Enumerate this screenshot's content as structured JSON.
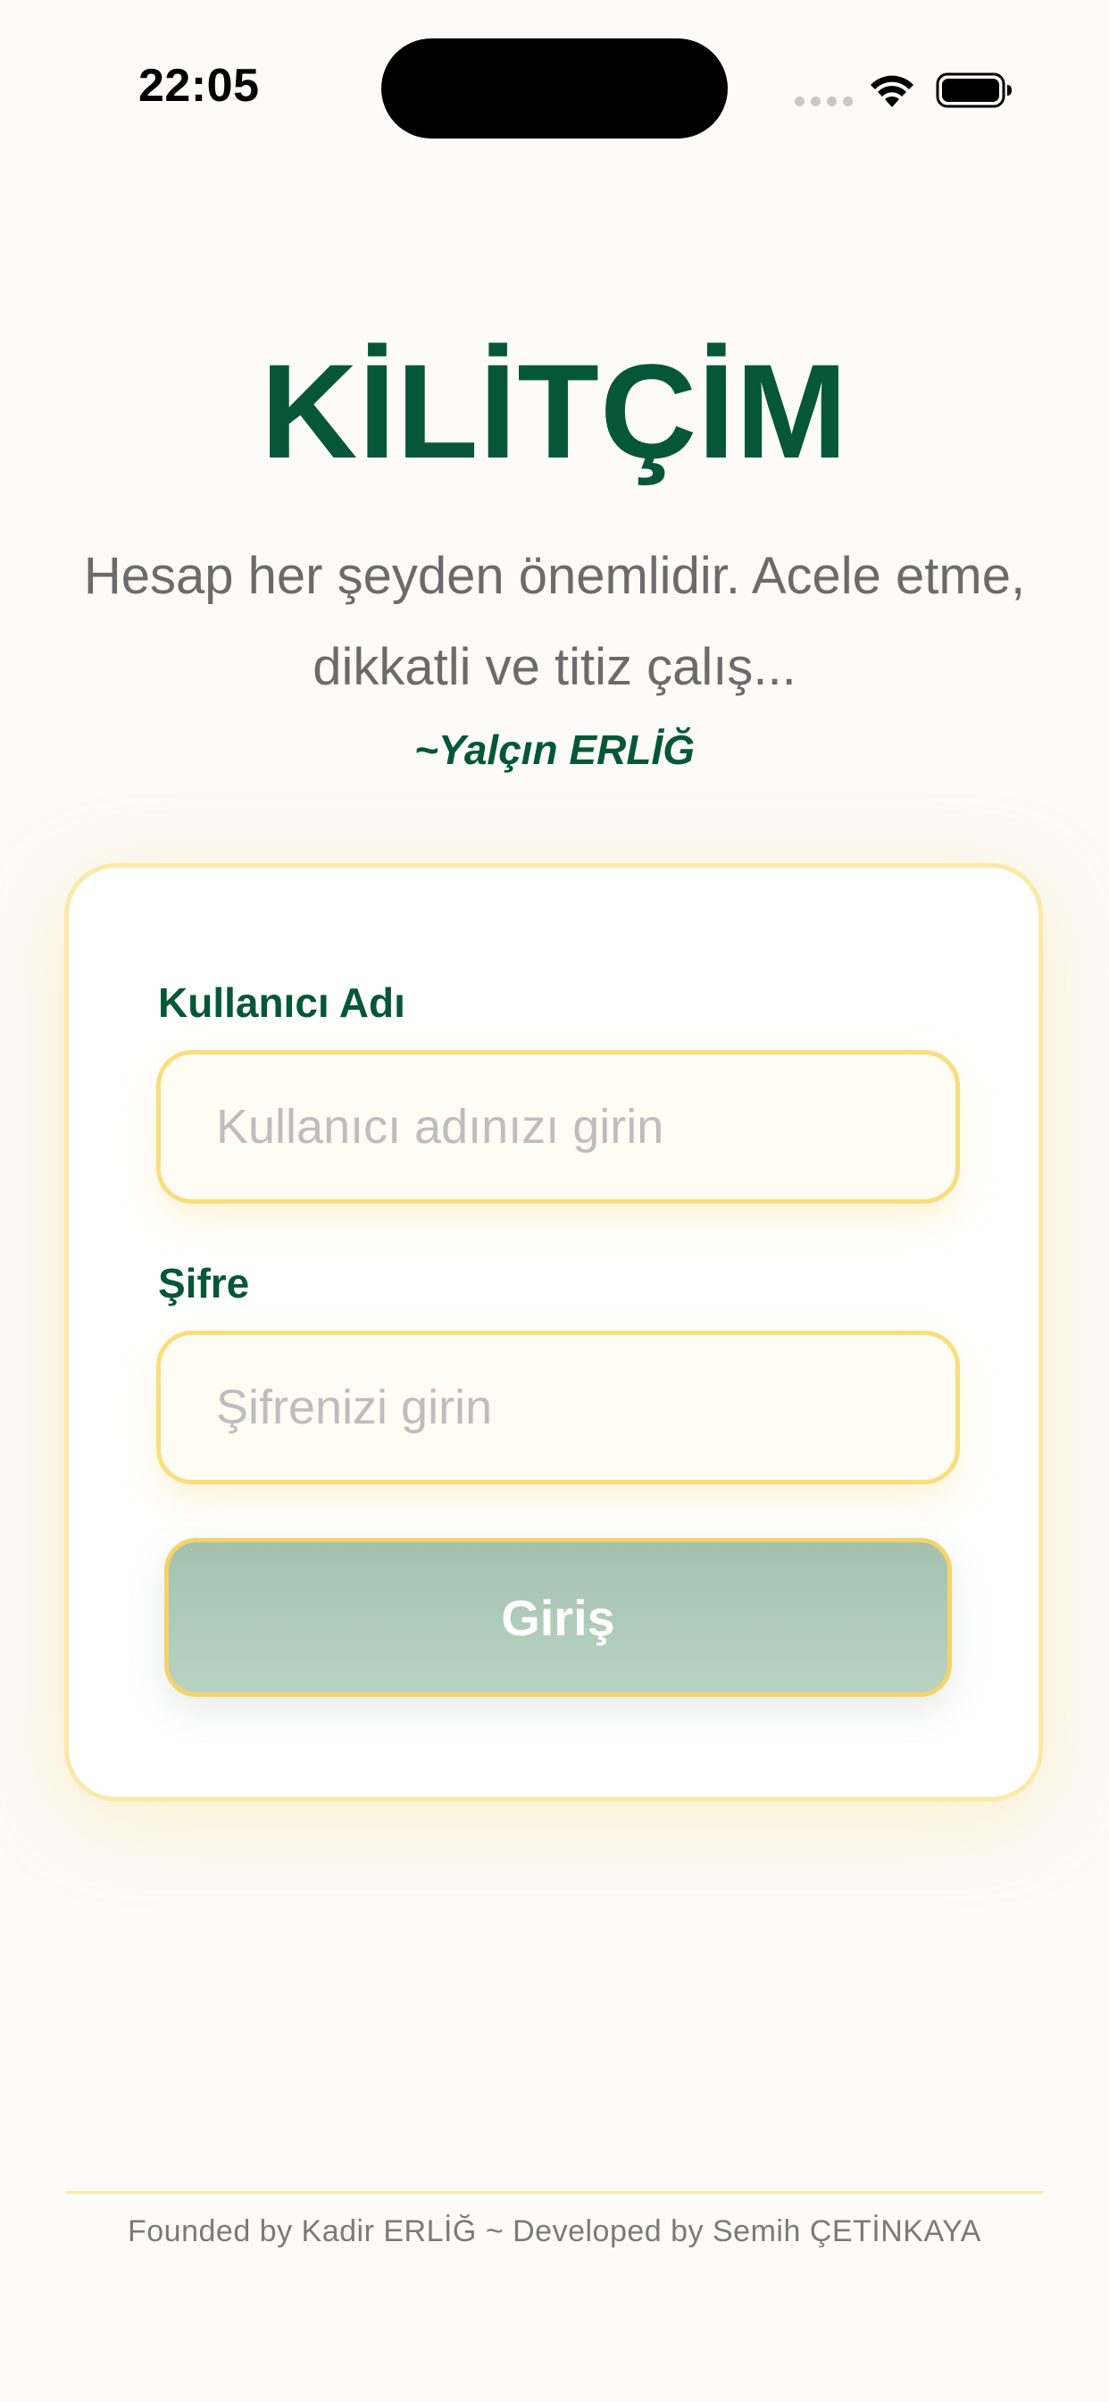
{
  "status_bar": {
    "time": "22:05"
  },
  "header": {
    "title": "KİLİTÇİM",
    "quote": "Hesap her şeyden önemlidir. Acele etme, dikkatli ve titiz çalış...",
    "quote_author": "~Yalçın ERLİĞ"
  },
  "login_form": {
    "username_label": "Kullanıcı Adı",
    "username_placeholder": "Kullanıcı adınızı girin",
    "username_value": "",
    "password_label": "Şifre",
    "password_placeholder": "Şifrenizi girin",
    "password_value": "",
    "submit_label": "Giriş"
  },
  "footer": {
    "credits": "Founded by Kadir ERLİĞ ~ Developed by Semih ÇETİNKAYA"
  },
  "colors": {
    "brand_green": "#06573a",
    "accent_yellow": "#f9de7c",
    "button_green": "#a4c1ae",
    "background": "#fcfbf8"
  }
}
